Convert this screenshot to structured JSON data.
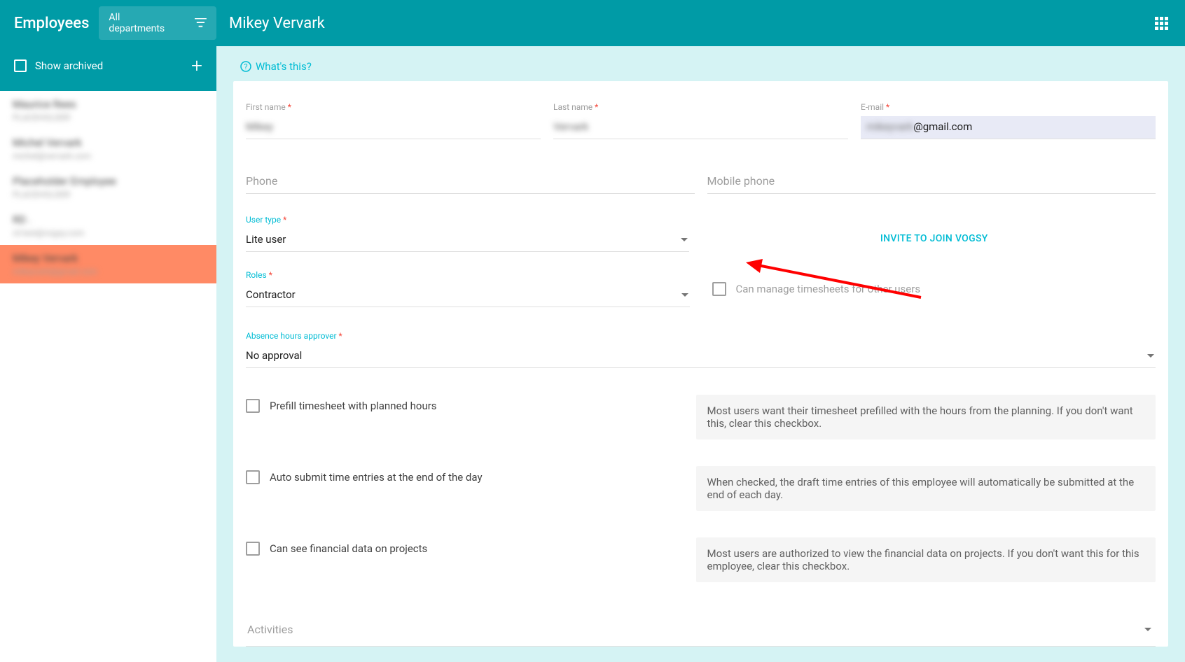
{
  "header": {
    "section_title": "Employees",
    "dept_filter": "All departments",
    "page_title": "Mikey Vervark"
  },
  "sidebar": {
    "show_archived_label": "Show archived",
    "items": [
      {
        "name": "Maurice Rees",
        "sub": "PLACEHOLDER"
      },
      {
        "name": "Michel Vervark",
        "sub": "michel@vervark.com"
      },
      {
        "name": "Placeholder Employee",
        "sub": "PLACEHOLDER"
      },
      {
        "name": "RD .",
        "sub": "rd.test@vogsy.com"
      },
      {
        "name": "Mikey Vervark",
        "sub": "mikeyvark@gmail.com"
      }
    ]
  },
  "whats_this": "What's this?",
  "form": {
    "first_name_label": "First name",
    "first_name_value": "Mikey",
    "last_name_label": "Last name",
    "last_name_value": "Vervark",
    "email_label": "E-mail",
    "email_value_blurred": "mikeyvark",
    "email_value_clear": "@gmail.com",
    "phone_label": "Phone",
    "mobile_label": "Mobile phone",
    "user_type_label": "User type",
    "user_type_value": "Lite user",
    "invite_label": "INVITE TO JOIN VOGSY",
    "roles_label": "Roles",
    "roles_value": "Contractor",
    "manage_timesheets_label": "Can manage timesheets for other users",
    "approver_label": "Absence hours approver",
    "approver_value": "No approval",
    "opt_prefill_label": "Prefill timesheet with planned hours",
    "opt_prefill_desc": "Most users want their timesheet prefilled with the hours from the planning. If you don't want this, clear this checkbox.",
    "opt_autosubmit_label": "Auto submit time entries at the end of the day",
    "opt_autosubmit_desc": "When checked, the draft time entries of this employee will automatically be submitted at the end of each day.",
    "opt_financial_label": "Can see financial data on projects",
    "opt_financial_desc": "Most users are authorized to view the financial data on projects. If you don't want this for this employee, clear this checkbox.",
    "activities_label": "Activities"
  }
}
